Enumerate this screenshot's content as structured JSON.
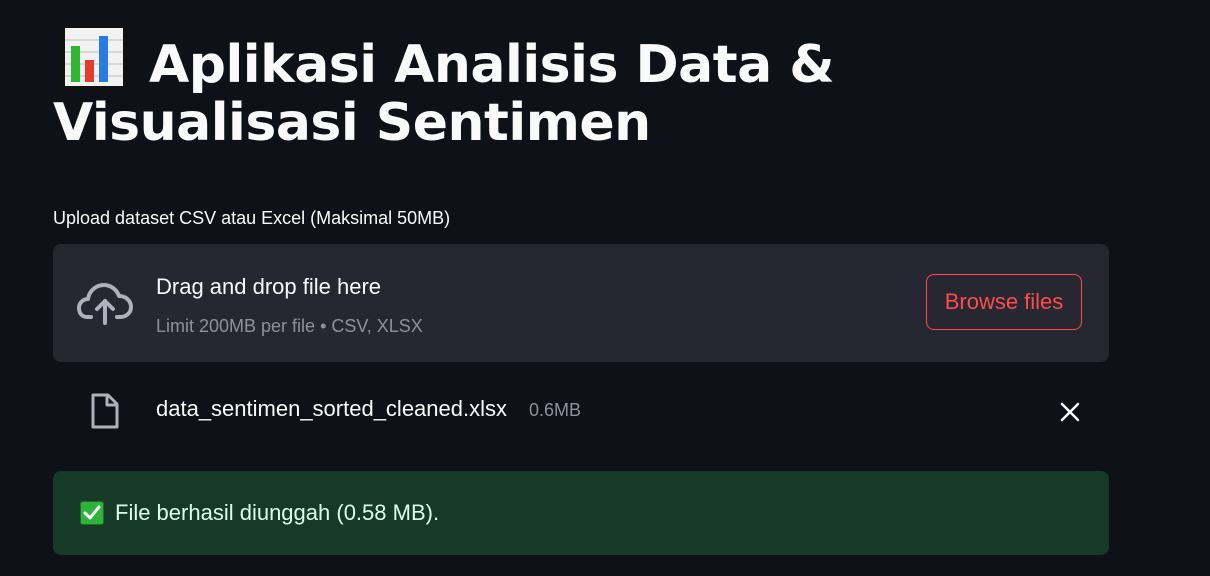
{
  "page": {
    "title": "Aplikasi Analisis Data & Visualisasi Sentimen",
    "title_icon": "bar-chart-icon"
  },
  "uploader": {
    "label": "Upload dataset CSV atau Excel (Maksimal 50MB)",
    "dropzone_title": "Drag and drop file here",
    "dropzone_subtitle": "Limit 200MB per file • CSV, XLSX",
    "upload_icon": "cloud-upload-icon",
    "browse_label": "Browse files",
    "accent_color": "#ff4b4b"
  },
  "uploaded_file": {
    "name": "data_sentimen_sorted_cleaned.xlsx",
    "size": "0.6MB",
    "file_icon": "file-icon",
    "remove_icon": "close-icon"
  },
  "alert": {
    "icon": "check-mark-icon",
    "text": "File berhasil diunggah (0.58 MB).",
    "background": "#173928"
  }
}
